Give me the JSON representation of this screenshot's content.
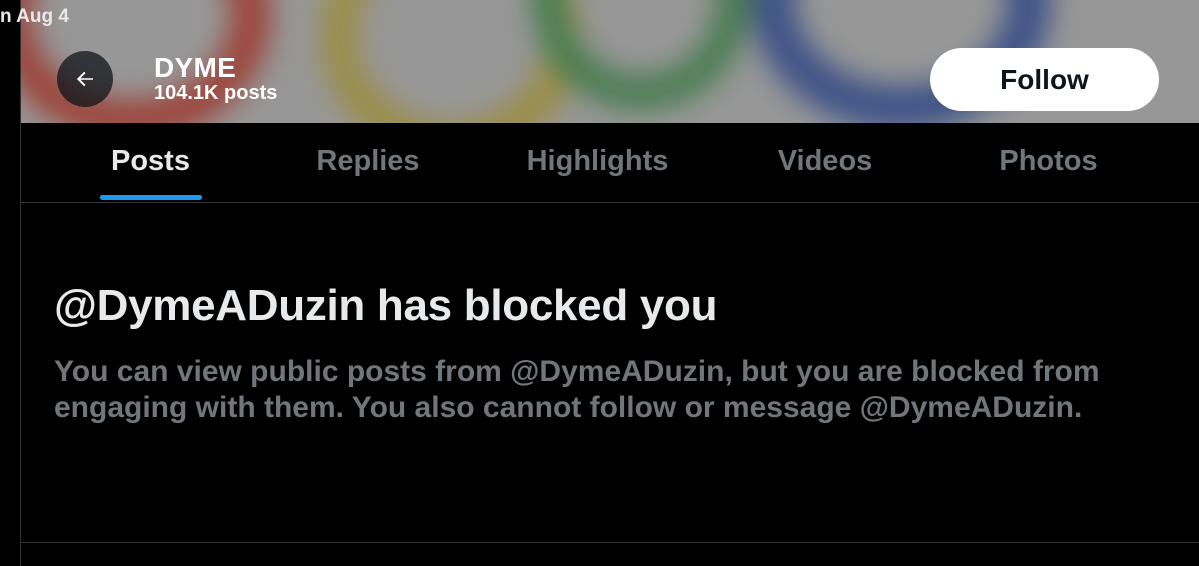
{
  "status": {
    "date_fragment": "n Aug 4"
  },
  "header": {
    "back_icon": "arrow-left-icon",
    "display_name": "DYME",
    "post_count": "104.1K posts",
    "follow_label": "Follow"
  },
  "tabs": [
    {
      "label": "Posts",
      "active": true
    },
    {
      "label": "Replies",
      "active": false
    },
    {
      "label": "Highlights",
      "active": false
    },
    {
      "label": "Videos",
      "active": false
    },
    {
      "label": "Photos",
      "active": false
    }
  ],
  "blocked": {
    "title": "@DymeADuzin has blocked you",
    "body": "You can view public posts from @DymeADuzin, but you are blocked from engaging with them. You also cannot follow or message @DymeADuzin."
  },
  "colors": {
    "background": "#000000",
    "accent": "#1d9bf0",
    "primary_text": "#e7e9ea",
    "secondary_text": "#71767b",
    "divider": "#2f3336"
  }
}
